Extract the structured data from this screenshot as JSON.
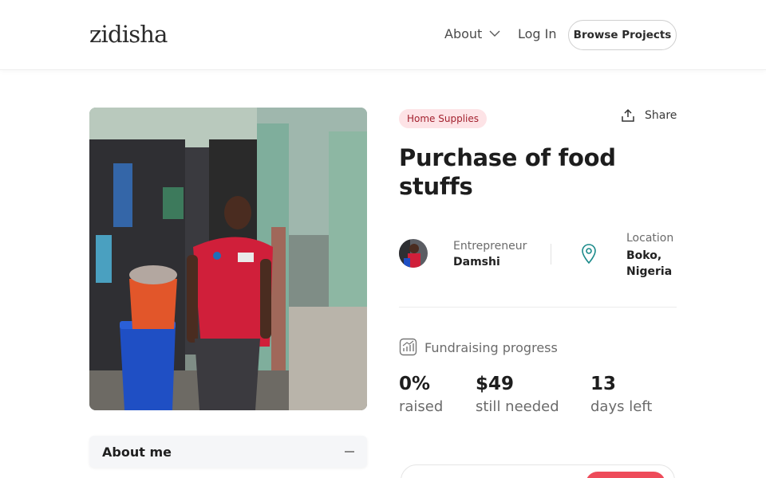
{
  "header": {
    "logo": "zidisha",
    "nav": {
      "about": "About",
      "login": "Log In"
    },
    "browse_button": "Browse Projects"
  },
  "about_panel": {
    "title": "About me"
  },
  "project": {
    "category": "Home Supplies",
    "share_label": "Share",
    "title": "Purchase of food stuffs",
    "entrepreneur": {
      "label": "Entrepreneur",
      "name": "Damshi"
    },
    "location": {
      "label": "Location",
      "value": "Boko, Nigeria"
    },
    "fundraising": {
      "label": "Fundraising progress",
      "raised": {
        "value": "0%",
        "label": "raised"
      },
      "needed": {
        "value": "$49",
        "label": "still needed"
      },
      "days": {
        "value": "13",
        "label": "days left"
      }
    }
  },
  "colors": {
    "accent": "#ee4b5a",
    "category_bg": "#fde3e6",
    "category_text": "#a3222f"
  }
}
